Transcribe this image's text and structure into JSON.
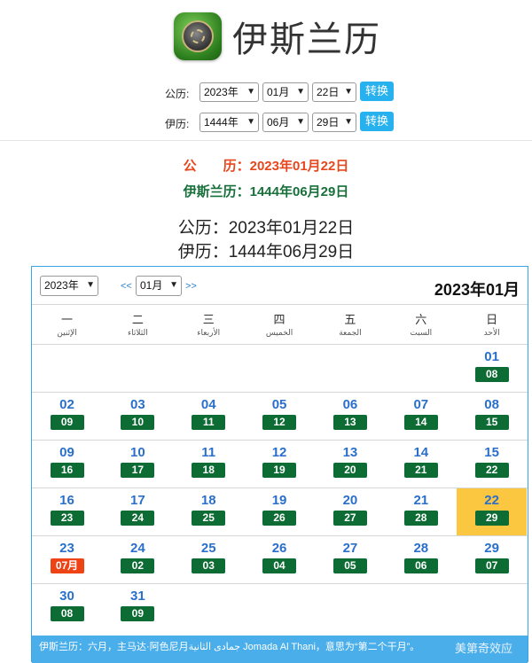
{
  "app": {
    "title": "伊斯兰历",
    "logo": "quran-emblem-icon"
  },
  "converter": {
    "gregorian": {
      "label": "公历:",
      "year": "2023年",
      "month": "01月",
      "day": "22日",
      "button": "转换"
    },
    "islamic": {
      "label": "伊历:",
      "year": "1444年",
      "month": "06月",
      "day": "29日",
      "button": "转换"
    }
  },
  "result": {
    "line1": "公　　历：2023年01月22日",
    "line2": "伊斯兰历：1444年06月29日",
    "line3": "公历：2023年01月22日",
    "line4": "伊历：1444年06月29日"
  },
  "calendar": {
    "year_select": "2023年",
    "month_select": "01月",
    "prev": "<<",
    "next": ">>",
    "title": "2023年01月",
    "weekdays": [
      {
        "cn": "一",
        "ar": "الإثنين"
      },
      {
        "cn": "二",
        "ar": "الثلاثاء"
      },
      {
        "cn": "三",
        "ar": "الأربعاء"
      },
      {
        "cn": "四",
        "ar": "الخميس"
      },
      {
        "cn": "五",
        "ar": "الجمعة"
      },
      {
        "cn": "六",
        "ar": "السبت"
      },
      {
        "cn": "日",
        "ar": "الأحد"
      }
    ],
    "weeks": [
      [
        null,
        null,
        null,
        null,
        null,
        null,
        {
          "g": "01",
          "h": "08"
        }
      ],
      [
        {
          "g": "02",
          "h": "09"
        },
        {
          "g": "03",
          "h": "10"
        },
        {
          "g": "04",
          "h": "11"
        },
        {
          "g": "05",
          "h": "12"
        },
        {
          "g": "06",
          "h": "13"
        },
        {
          "g": "07",
          "h": "14"
        },
        {
          "g": "08",
          "h": "15"
        }
      ],
      [
        {
          "g": "09",
          "h": "16"
        },
        {
          "g": "10",
          "h": "17"
        },
        {
          "g": "11",
          "h": "18"
        },
        {
          "g": "12",
          "h": "19"
        },
        {
          "g": "13",
          "h": "20"
        },
        {
          "g": "14",
          "h": "21"
        },
        {
          "g": "15",
          "h": "22"
        }
      ],
      [
        {
          "g": "16",
          "h": "23"
        },
        {
          "g": "17",
          "h": "24"
        },
        {
          "g": "18",
          "h": "25"
        },
        {
          "g": "19",
          "h": "26"
        },
        {
          "g": "20",
          "h": "27"
        },
        {
          "g": "21",
          "h": "28"
        },
        {
          "g": "22",
          "h": "29",
          "today": true
        }
      ],
      [
        {
          "g": "23",
          "h": "07月",
          "month": true
        },
        {
          "g": "24",
          "h": "02"
        },
        {
          "g": "25",
          "h": "03"
        },
        {
          "g": "26",
          "h": "04"
        },
        {
          "g": "27",
          "h": "05"
        },
        {
          "g": "28",
          "h": "06"
        },
        {
          "g": "29",
          "h": "07"
        }
      ],
      [
        {
          "g": "30",
          "h": "08"
        },
        {
          "g": "31",
          "h": "09"
        },
        null,
        null,
        null,
        null,
        null
      ]
    ],
    "footer": "伊斯兰历：六月，主马达·阿色尼月جمادى الثانية Jomada Al Thani，意思为“第二个干月”。",
    "watermark": "美第奇效应"
  },
  "colors": {
    "accent": "#27b1ee",
    "hijri_badge": "#0d6b34",
    "today": "#fcc740",
    "month_badge": "#ee4315"
  }
}
